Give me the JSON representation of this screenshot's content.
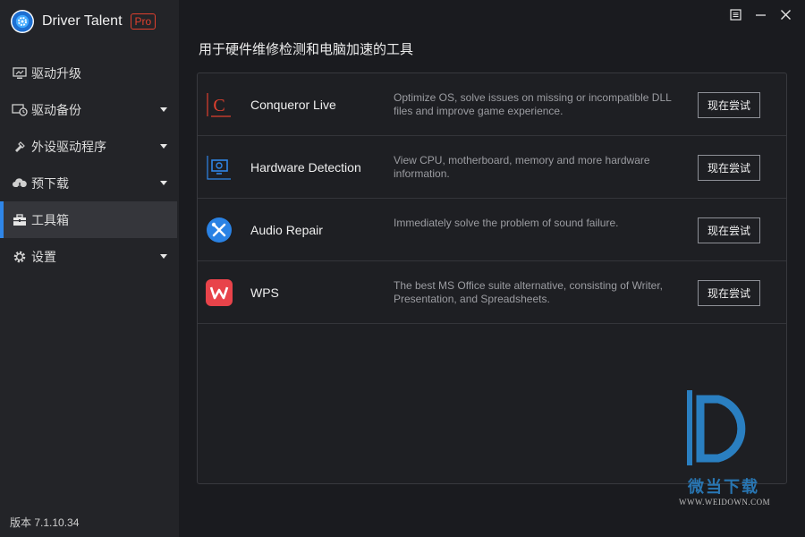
{
  "app": {
    "name": "Driver Talent",
    "badge": "Pro",
    "version": "版本 7.1.10.34"
  },
  "sidebar": {
    "items": [
      {
        "label": "驱动升级",
        "icon": "monitor-icon",
        "expandable": false,
        "active": false
      },
      {
        "label": "驱动备份",
        "icon": "backup-icon",
        "expandable": true,
        "active": false
      },
      {
        "label": "外设驱动程序",
        "icon": "peripheral-icon",
        "expandable": true,
        "active": false
      },
      {
        "label": "预下载",
        "icon": "cloud-download-icon",
        "expandable": true,
        "active": false
      },
      {
        "label": "工具箱",
        "icon": "toolbox-icon",
        "expandable": false,
        "active": true
      },
      {
        "label": "设置",
        "icon": "gear-icon",
        "expandable": true,
        "active": false
      }
    ]
  },
  "main": {
    "heading": "用于硬件维修检测和电脑加速的工具",
    "tools": [
      {
        "name": "Conqueror Live",
        "description": "Optimize OS, solve issues on missing or incompatible DLL files and improve game experience.",
        "button": "现在尝试",
        "icon": "conqueror-icon"
      },
      {
        "name": "Hardware Detection",
        "description": "View CPU, motherboard, memory and more hardware information.",
        "button": "现在尝试",
        "icon": "hardware-detection-icon"
      },
      {
        "name": "Audio Repair",
        "description": "Immediately solve the problem of sound failure.",
        "button": "现在尝试",
        "icon": "audio-repair-icon"
      },
      {
        "name": "WPS",
        "description": "The best MS Office suite alternative, consisting of Writer, Presentation, and Spreadsheets.",
        "button": "现在尝试",
        "icon": "wps-icon"
      }
    ]
  },
  "watermark": {
    "cn": "微当下载",
    "en": "WWW.WEIDOWN.COM"
  },
  "colors": {
    "accent": "#2f86e8",
    "badge": "#e0402e",
    "background": "#1a1b1f",
    "sidebar": "#232428"
  }
}
